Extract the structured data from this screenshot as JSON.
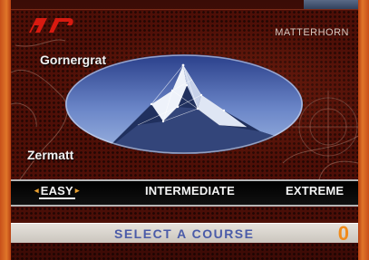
{
  "header": {
    "logo_text": "ar",
    "peak_name": "MATTERHORN"
  },
  "map": {
    "location_top": "Gornergrat",
    "location_bottom": "Zermatt"
  },
  "difficulty_menu": {
    "options": [
      {
        "label": "EASY",
        "selected": true
      },
      {
        "label": "INTERMEDIATE",
        "selected": false
      },
      {
        "label": "EXTREME",
        "selected": false
      }
    ],
    "left_arrow": "◂",
    "right_arrow": "▸"
  },
  "status": {
    "prompt": "SELECT A COURSE",
    "count": "0"
  },
  "colors": {
    "accent_orange": "#f08a1a",
    "prompt_blue": "#4a5ba8",
    "panel_red": "#4e0f07"
  }
}
